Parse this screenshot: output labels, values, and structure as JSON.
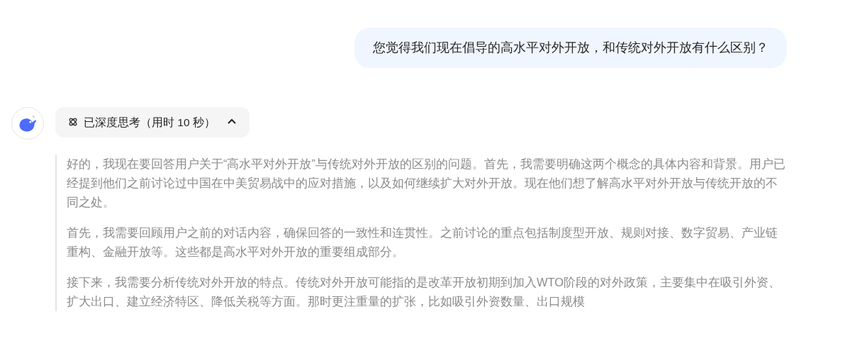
{
  "user_message": {
    "text": "您觉得我们现在倡导的高水平对外开放，和传统对外开放有什么区别？"
  },
  "assistant": {
    "thinking_toggle": {
      "label": "已深度思考（用时 10 秒）",
      "expanded": true
    },
    "thinking_paragraphs": [
      "好的，我现在要回答用户关于“高水平对外开放”与传统对外开放的区别的问题。首先，我需要明确这两个概念的具体内容和背景。用户已经提到他们之前讨论过中国在中美贸易战中的应对措施，以及如何继续扩大对外开放。现在他们想了解高水平对外开放与传统开放的不同之处。",
      "首先，我需要回顾用户之前的对话内容，确保回答的一致性和连贯性。之前讨论的重点包括制度型开放、规则对接、数字贸易、产业链重构、金融开放等。这些都是高水平对外开放的重要组成部分。",
      "接下来，我需要分析传统对外开放的特点。传统对外开放可能指的是改革开放初期到加入WTO阶段的对外政策，主要集中在吸引外资、扩大出口、建立经济特区、降低关税等方面。那时更注重量的扩张，比如吸引外资数量、出口规模"
    ]
  }
}
